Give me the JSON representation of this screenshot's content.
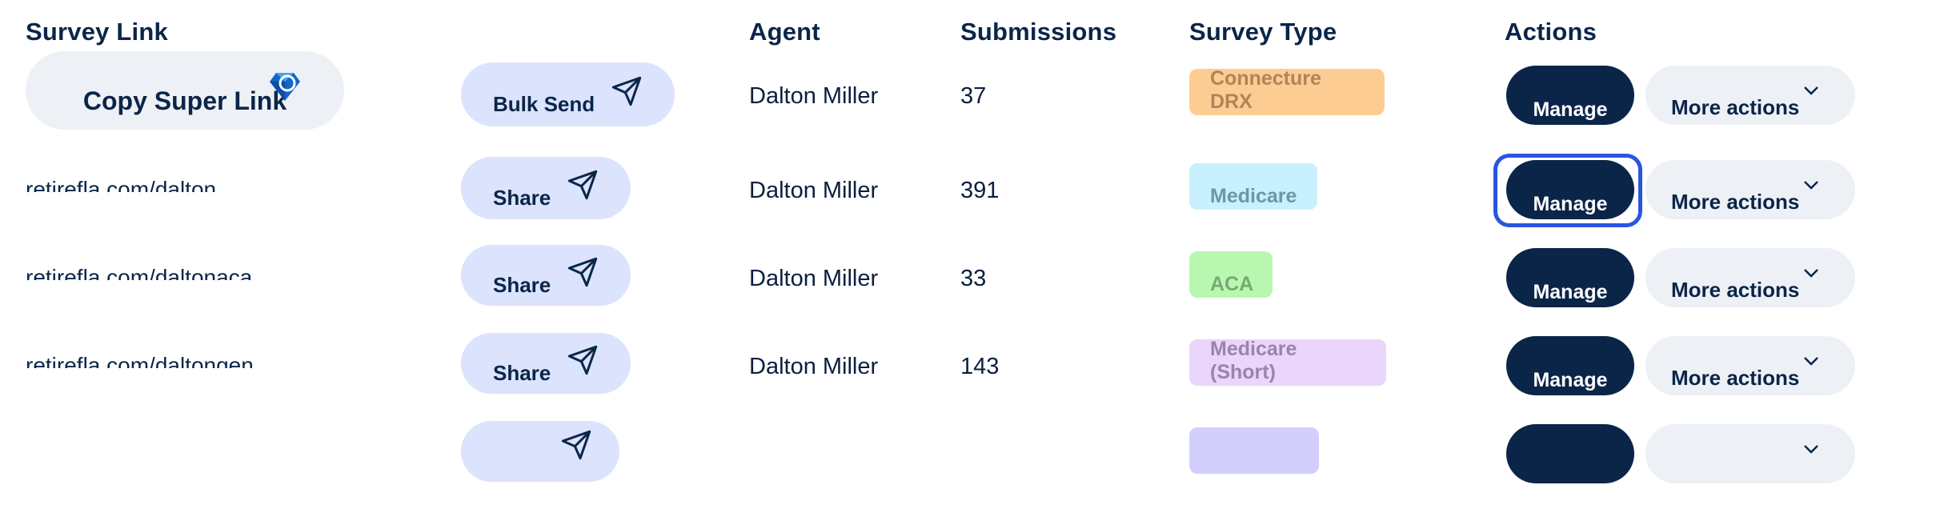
{
  "headers": {
    "survey_link": "Survey Link",
    "agent": "Agent",
    "submissions": "Submissions",
    "survey_type": "Survey Type",
    "actions": "Actions"
  },
  "colors": {
    "navy": "#0b2549",
    "share_bg": "#dbe3fd",
    "more_bg": "#edf1f6",
    "focus_ring": "#2a55e0"
  },
  "rows": [
    {
      "link_label": "Copy Super Link",
      "link_icon": "diamond-icon",
      "send_label": "Bulk Send",
      "agent": "Dalton Miller",
      "submissions": "37",
      "survey_type": "Connecture DRX",
      "badge_bg": "#fdcc92",
      "badge_fg": "#b38357",
      "manage": "Manage",
      "more": "More actions"
    },
    {
      "link_label": "retirefla.com/dalton",
      "send_label": "Share",
      "agent": "Dalton Miller",
      "submissions": "391",
      "survey_type": "Medicare",
      "badge_bg": "#c9f0fd",
      "badge_fg": "#6a98a8",
      "manage": "Manage",
      "more": "More actions",
      "focused": true
    },
    {
      "link_label": "retirefla.com/daltonaca",
      "send_label": "Share",
      "agent": "Dalton Miller",
      "submissions": "33",
      "survey_type": "ACA",
      "badge_bg": "#b8f7b0",
      "badge_fg": "#7aa874",
      "manage": "Manage",
      "more": "More actions"
    },
    {
      "link_label": "retirefla.com/daltongen",
      "send_label": "Share",
      "agent": "Dalton Miller",
      "submissions": "143",
      "survey_type": "Medicare (Short)",
      "badge_bg": "#ead5fb",
      "badge_fg": "#9a84ad",
      "manage": "Manage",
      "more": "More actions"
    },
    {
      "link_label": "",
      "send_label": "",
      "agent": "",
      "submissions": "",
      "survey_type": "",
      "badge_bg": "#d3cffd",
      "badge_fg": "#8b86b3",
      "manage": "",
      "more": ""
    }
  ]
}
